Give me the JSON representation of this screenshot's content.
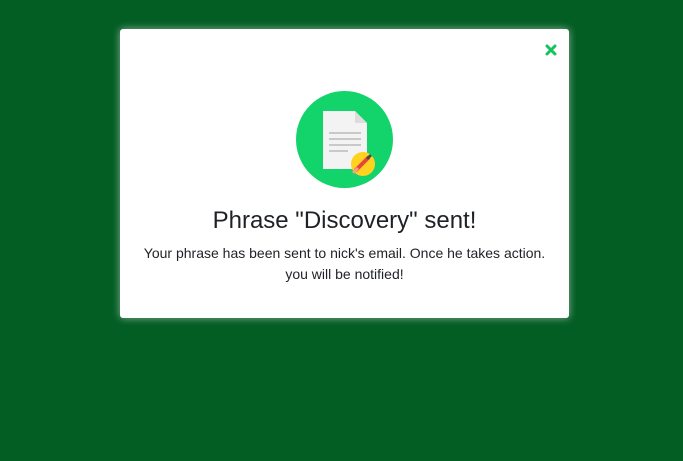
{
  "colors": {
    "background": "#035e24",
    "accent": "#13d36b",
    "close_icon": "#13c45e",
    "text": "#1e2126"
  },
  "modal": {
    "close_icon": "close-icon",
    "illustration_icon": "document-with-pencil-icon",
    "title": "Phrase \"Discovery\" sent!",
    "message_line1": "Your phrase has been sent to nick's email. Once he takes action.",
    "message_line2": "you will be notified!"
  }
}
